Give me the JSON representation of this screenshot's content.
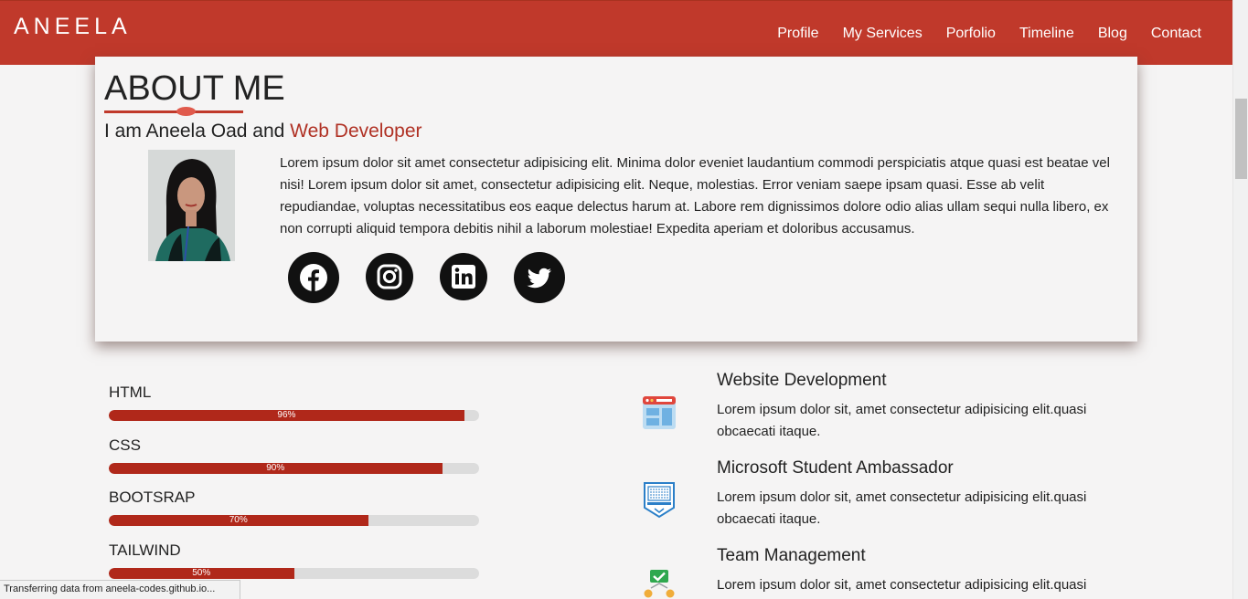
{
  "brand": "ANEELA",
  "nav": [
    "Profile",
    "My Services",
    "Porfolio",
    "Timeline",
    "Blog",
    "Contact"
  ],
  "about": {
    "title": "ABOUT ME",
    "intro_prefix": "I am Aneela Oad and ",
    "intro_role": "Web Developer",
    "text": "Lorem ipsum dolor sit amet consectetur adipisicing elit. Minima dolor eveniet laudantium commodi perspiciatis atque quasi est beatae vel nisi! Lorem ipsum dolor sit amet, consectetur adipisicing elit. Neque, molestias. Error veniam saepe ipsam quasi. Esse ab velit repudiandae, voluptas necessitatibus eos eaque delectus harum at. Labore rem dignissimos dolore odio alias ullam sequi nulla libero, ex non corrupti aliquid tempora debitis nihil a laborum molestiae! Expedita aperiam et doloribus accusamus.",
    "socials": [
      "facebook-icon",
      "instagram-icon",
      "linkedin-icon",
      "twitter-icon"
    ]
  },
  "skills": [
    {
      "name": "HTML",
      "percent": 96,
      "label": "96%"
    },
    {
      "name": "CSS",
      "percent": 90,
      "label": "90%"
    },
    {
      "name": "BOOTSRAP",
      "percent": 70,
      "label": "70%"
    },
    {
      "name": "TAILWIND",
      "percent": 50,
      "label": "50%"
    }
  ],
  "services": [
    {
      "title": "Website Development",
      "desc": "Lorem ipsum dolor sit, amet consectetur adipisicing elit.quasi obcaecati itaque.",
      "icon": "website-icon"
    },
    {
      "title": "Microsoft Student Ambassador",
      "desc": "Lorem ipsum dolor sit, amet consectetur adipisicing elit.quasi obcaecati itaque.",
      "icon": "ambassador-badge-icon"
    },
    {
      "title": "Team Management",
      "desc": "Lorem ipsum dolor sit, amet consectetur adipisicing elit.quasi obcaecati itaque.",
      "icon": "team-icon"
    }
  ],
  "status": "Transferring data from aneela-codes.github.io...",
  "colors": {
    "accent": "#c0392b",
    "bar_fill": "#b0281a",
    "bar_track": "#dcdcdc"
  }
}
